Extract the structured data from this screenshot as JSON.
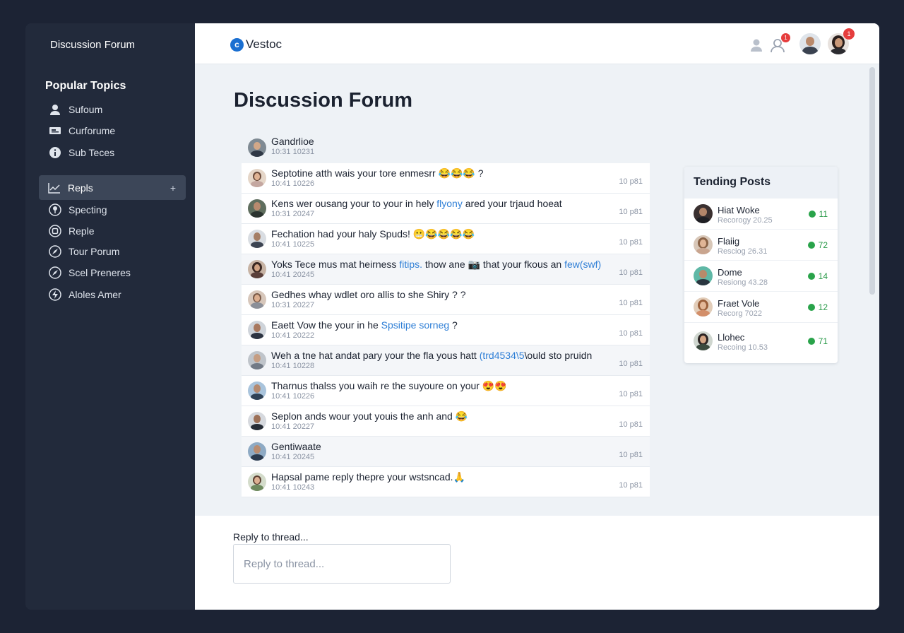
{
  "sidebar": {
    "title": "Discussion Forum",
    "heading": "Popular Topics",
    "items": [
      {
        "label": "Sufoum",
        "icon": "user-icon"
      },
      {
        "label": "Curforume",
        "icon": "keyboard-icon"
      },
      {
        "label": "Sub Teces",
        "icon": "info-icon"
      },
      {
        "label": "Repls",
        "icon": "chart-icon",
        "active": true
      },
      {
        "label": "Specting",
        "icon": "pin-icon"
      },
      {
        "label": "Reple",
        "icon": "square-icon"
      },
      {
        "label": "Tour Porum",
        "icon": "compass-icon"
      },
      {
        "label": "Scel Preneres",
        "icon": "compass-icon"
      },
      {
        "label": "Aloles Amer",
        "icon": "bolt-icon"
      }
    ],
    "plus_label": "+"
  },
  "header": {
    "brand": "Vestoc",
    "logo_letter": "c",
    "notif_count_1": "1",
    "notif_count_2": "1"
  },
  "main": {
    "title": "Discussion Forum"
  },
  "thread": {
    "posts": [
      {
        "text": "Gandrlioe",
        "meta": "10:31 10231",
        "time": ""
      },
      {
        "text": "Septotine atth wais your tore enmesrr 😂😂😂 ?",
        "meta": "10:41 10226",
        "time": "10 p81"
      },
      {
        "text": "Kens wer ousang your to your in hely",
        "link": "flyony",
        "text2": " ared your trjaud hoeat",
        "meta": "10:31 20247",
        "time": "10 p81"
      },
      {
        "text": "Fechation had your haly Spuds! 😬😂😂😂😂",
        "meta": "10:41 10225",
        "time": "10 p81"
      },
      {
        "text": "Yoks Tece mus mat heirness",
        "link": "fitips.",
        "text2": " thow ane 📷 that your fkous an ",
        "link2": "few(swf)",
        "meta": "10:41 20245",
        "time": "10 p81"
      },
      {
        "text": "Gedhes whay wdlet oro allis to she Shiry ? ?",
        "meta": "10:31 20227",
        "time": "10 p81"
      },
      {
        "text": "Eaett Vow the your in he",
        "link": "Spsitipe sorneg",
        "text2": " ?",
        "meta": "10:41 20222",
        "time": "10 p81"
      },
      {
        "text": "Weh a tne hat andat pary your the fla yous hatt",
        "link": "(trd4534\\5",
        "text2": "\\ould sto pruidn",
        "meta": "10:41 10228",
        "time": "10 p81"
      },
      {
        "text": "Tharnus thalss you waih re the suyoure on your 😍😍",
        "meta": "10:41 10226",
        "time": "10 p81"
      },
      {
        "text": "Seplon ands wour yout youis the anh and 😂",
        "meta": "10:41 20227",
        "time": "10 p81"
      },
      {
        "text": "Gentiwaate",
        "meta": "10:41 20245",
        "time": "10 p81"
      },
      {
        "text": "Hapsal pame reply thepre your wstsncad.🙏",
        "meta": "10:41 10243",
        "time": "10 p81"
      }
    ]
  },
  "trending": {
    "title": "Tending Posts",
    "items": [
      {
        "name": "Hiat Woke",
        "sub": "Recorogy 20.25",
        "count": "11"
      },
      {
        "name": "Flaiig",
        "sub": "Resciog 26.31",
        "count": "72"
      },
      {
        "name": "Dome",
        "sub": "Resiong 43.28",
        "count": "14"
      },
      {
        "name": "Fraet Vole",
        "sub": "Recorg 7022",
        "count": "12"
      },
      {
        "name": "Llohec",
        "sub": "Recoing 10.53",
        "count": "71"
      }
    ]
  },
  "reply": {
    "label": "Reply to thread...",
    "placeholder": "Reply to thread..."
  },
  "colors": {
    "sidebar_bg": "#222a3b",
    "active_item": "#3c4658",
    "link": "#2f7fd6",
    "count_green": "#29a34a",
    "badge_red": "#e53d3d"
  }
}
